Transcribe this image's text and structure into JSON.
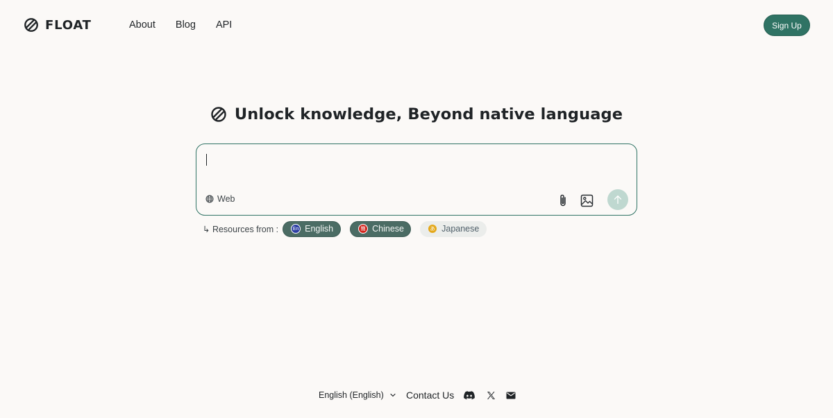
{
  "brand": {
    "name": "FLOAT",
    "accent": "#2f7364"
  },
  "nav": {
    "items": [
      {
        "label": "About"
      },
      {
        "label": "Blog"
      },
      {
        "label": "API"
      }
    ],
    "signup_label": "Sign Up"
  },
  "hero": {
    "title": "Unlock knowledge, Beyond native language"
  },
  "search": {
    "value": "",
    "web_label": "Web",
    "icons": [
      "globe-icon",
      "paperclip-icon",
      "image-icon",
      "arrow-up-icon"
    ]
  },
  "resources": {
    "label": "↳ Resources from :",
    "languages": [
      {
        "code": "En",
        "label": "English",
        "selected": true,
        "color": "#2c3ea3"
      },
      {
        "code": "簡",
        "label": "Chinese",
        "selected": true,
        "color": "#d2241c"
      },
      {
        "code": "あ",
        "label": "Japanese",
        "selected": false,
        "color": "#e4a81a"
      }
    ]
  },
  "footer": {
    "language_select": "English (English)",
    "contact_label": "Contact Us",
    "social_icons": [
      "discord-icon",
      "x-icon",
      "mail-icon"
    ]
  }
}
